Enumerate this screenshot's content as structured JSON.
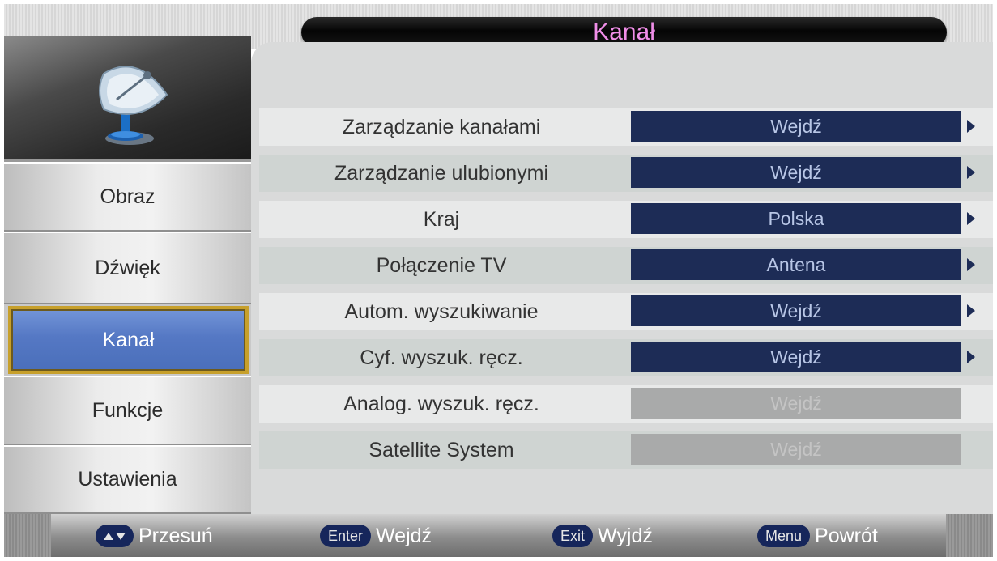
{
  "title": "Kanał",
  "colors": {
    "title_text": "#f08ee8",
    "value_box": "#1d2c56",
    "active_item": "#5578c4",
    "active_border": "#c7a02c",
    "key_badge": "#16265b"
  },
  "sidebar": {
    "icon": "satellite-dish-icon",
    "items": [
      {
        "label": "Obraz"
      },
      {
        "label": "Dźwięk"
      },
      {
        "label": "Kanał",
        "active": true
      },
      {
        "label": "Funkcje"
      },
      {
        "label": "Ustawienia"
      }
    ]
  },
  "menu": {
    "rows": [
      {
        "label": "Zarządzanie kanałami",
        "value": "Wejdź",
        "enabled": true
      },
      {
        "label": "Zarządzanie ulubionymi",
        "value": "Wejdź",
        "enabled": true
      },
      {
        "label": "Kraj",
        "value": "Polska",
        "enabled": true
      },
      {
        "label": "Połączenie TV",
        "value": "Antena",
        "enabled": true
      },
      {
        "label": "Autom. wyszukiwanie",
        "value": "Wejdź",
        "enabled": true
      },
      {
        "label": "Cyf. wyszuk. ręcz.",
        "value": "Wejdź",
        "enabled": true
      },
      {
        "label": "Analog. wyszuk. ręcz.",
        "value": "Wejdź",
        "enabled": false
      },
      {
        "label": "Satellite System",
        "value": "Wejdź",
        "enabled": false
      }
    ]
  },
  "footer": {
    "hints": [
      {
        "key": "",
        "key_icon": "up-down-arrows-icon",
        "label": "Przesuń"
      },
      {
        "key": "Enter",
        "label": "Wejdź"
      },
      {
        "key": "Exit",
        "label": "Wyjdź"
      },
      {
        "key": "Menu",
        "label": "Powrót"
      }
    ]
  }
}
